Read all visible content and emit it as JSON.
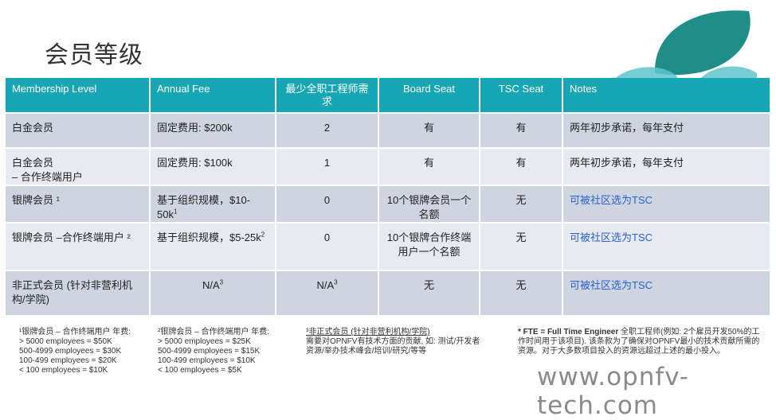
{
  "title": "会员等级",
  "table": {
    "headers": [
      "Membership Level",
      "Annual Fee",
      "最少全职工程师需求",
      "Board Seat",
      "TSC Seat",
      "Notes"
    ],
    "rows": [
      {
        "level": "白金会员",
        "level2": "",
        "fee": "固定费用: $200k",
        "fee_sup": "",
        "fte": "2",
        "fte_sup": "",
        "board": "有",
        "tsc": "有",
        "notes": "两年初步承诺，每年支付",
        "notes_link": false
      },
      {
        "level": "白金会员",
        "level2": "– 合作终端用户",
        "fee": "固定费用: $100k",
        "fee_sup": "",
        "fte": "1",
        "fte_sup": "",
        "board": "有",
        "tsc": "有",
        "notes": "两年初步承诺，每年支付",
        "notes_link": false
      },
      {
        "level": "银牌会员 ¹",
        "level2": "",
        "fee": "基于组织规模，$10-50k",
        "fee_sup": "1",
        "fte": "0",
        "fte_sup": "",
        "board": "10个银牌会员一个名额",
        "tsc": "无",
        "notes": "可被社区选为TSC",
        "notes_link": true
      },
      {
        "level": "银牌会员 –合作终端用户 ²",
        "level2": "",
        "fee": "基于组织规模，$5-25k",
        "fee_sup": "2",
        "fte": "0",
        "fte_sup": "",
        "board": "10个银牌合作终端用户一个名额",
        "tsc": "无",
        "notes": "可被社区选为TSC",
        "notes_link": true
      },
      {
        "level": "非正式会员 (针对非营利机构/学院)",
        "level2": "",
        "fee": "N/A",
        "fee_sup": "3",
        "fte": "N/A",
        "fte_sup": "3",
        "board": "无",
        "tsc": "无",
        "notes": "可被社区选为TSC",
        "notes_link": true
      }
    ]
  },
  "footnotes": {
    "f1": {
      "heading": "¹银牌会员 – 合作终端用户  年费:",
      "lines": [
        "> 5000 employees = $50K",
        "500-4999 employees = $30K",
        "100-499 employees = $20K",
        "< 100 employees = $10K"
      ]
    },
    "f2": {
      "heading": "²银牌会员 – 合作终端用户 年费:",
      "lines": [
        "> 5000 employees = $25K",
        "500-4999 employees = $15K",
        "100-499 employees = $10K",
        "< 100 employees = $5K"
      ]
    },
    "f3": {
      "heading": "³非正式会员 (针对非营利机构/学院)",
      "lines": [
        "需要对OPNFV有技术方面的贡献, 如: 测试/开发者",
        "资源/举办技术峰会/培训/研究/等等"
      ]
    },
    "f4": {
      "prefix": "* FTE = Full Time Engineer",
      "text": " 全职工程师(例如: 2个雇员开发50%的工作时间用于该项目). 该条款为了确保对OPNFV最小的技术贡献所需的资源。对于大多数项目投入的资源远超过上述的最小投入。"
    }
  },
  "watermark": "www.opnfv-tech.com",
  "colors": {
    "header": "#17a6b3",
    "row_odd": "#cfd4e1",
    "row_even": "#e8eaf1",
    "link": "#2a62c9",
    "deco_dark": "#1e8e87",
    "deco_light": "#5ec4cc"
  }
}
